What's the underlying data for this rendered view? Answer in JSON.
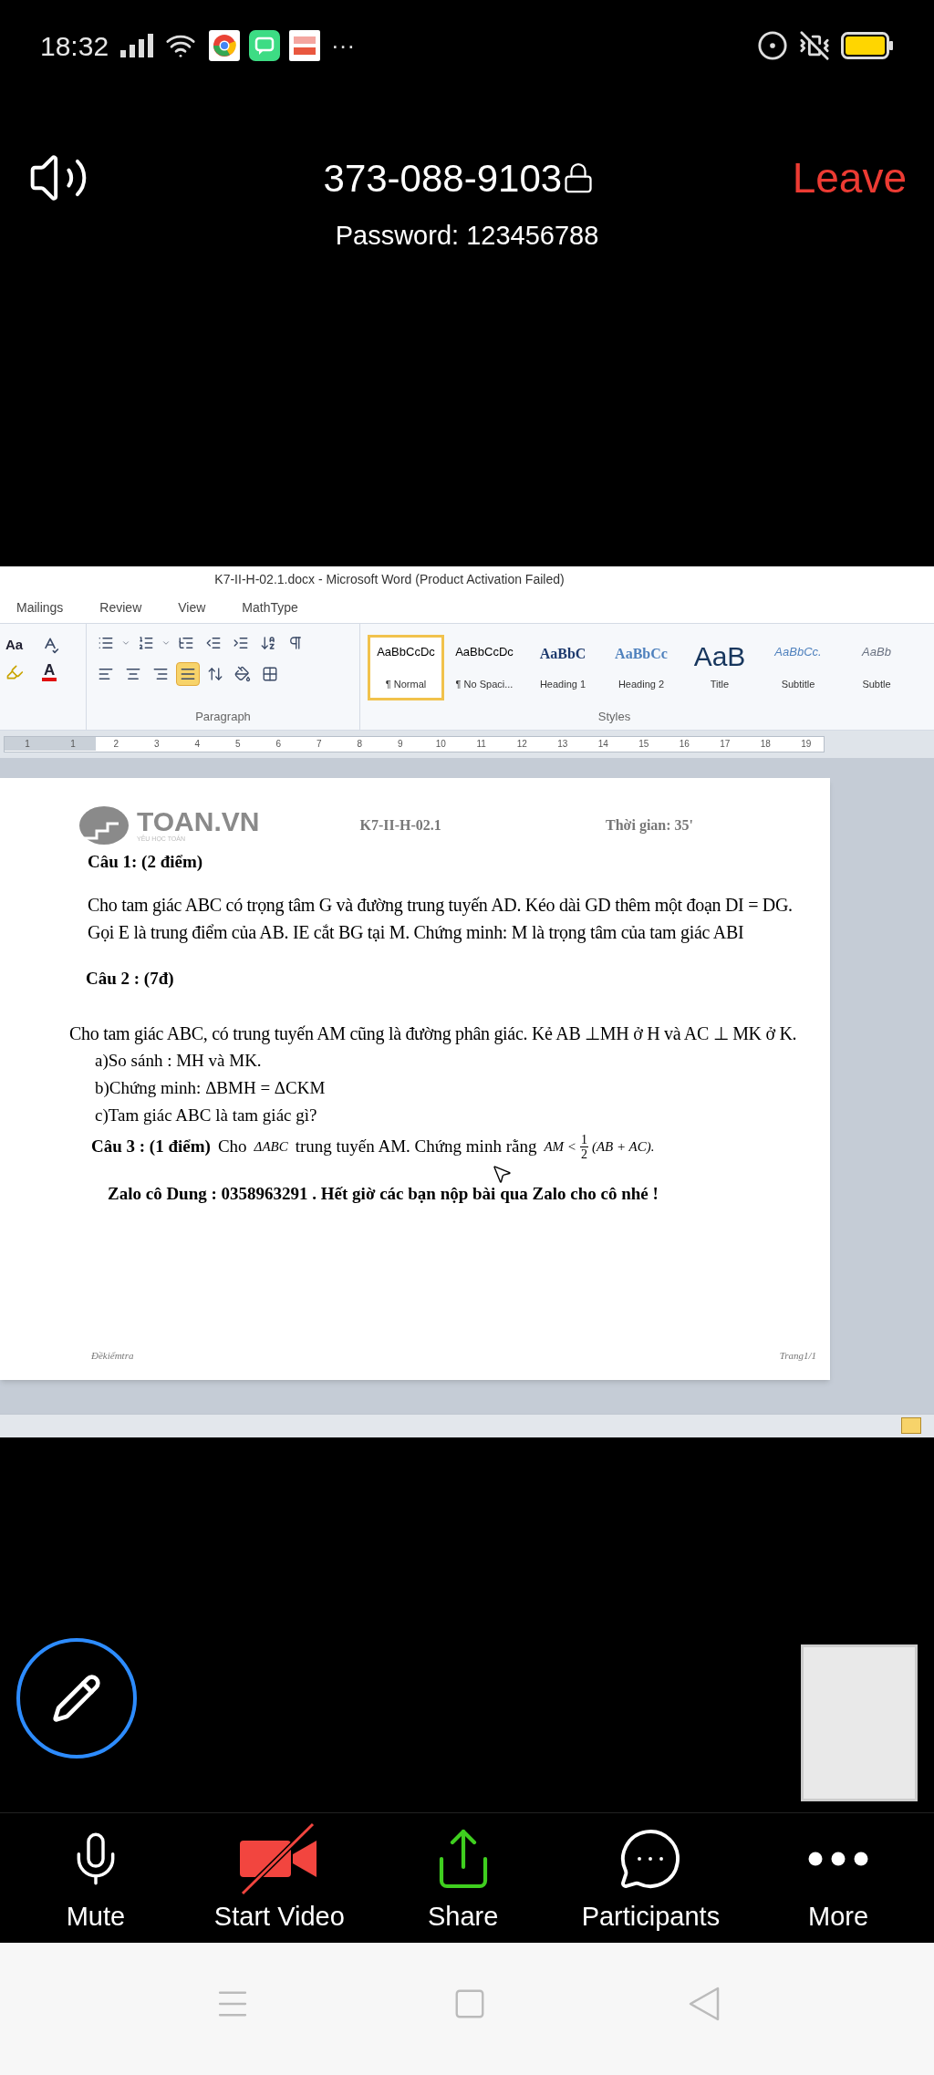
{
  "status_bar": {
    "time": "18:32",
    "more_notifications": "···"
  },
  "meeting": {
    "id": "373-088-9103",
    "password": "Password: 123456788",
    "leave": "Leave"
  },
  "word": {
    "title": "K7-II-H-02.1.docx  -  Microsoft Word (Product Activation Failed)",
    "tabs": [
      "Mailings",
      "Review",
      "View",
      "MathType"
    ],
    "font_case_button": "Aa",
    "font_color_button": "A",
    "alignments": [
      {
        "kind": "left",
        "selected": false
      },
      {
        "kind": "center",
        "selected": false
      },
      {
        "kind": "right",
        "selected": false
      },
      {
        "kind": "justify",
        "selected": true
      }
    ],
    "styles": [
      {
        "kind": "normal",
        "preview": "AaBbCcDc",
        "name": "¶ Normal",
        "selected": true
      },
      {
        "kind": "nospacing",
        "preview": "AaBbCcDc",
        "name": "¶ No Spaci...",
        "selected": false
      },
      {
        "kind": "heading1",
        "preview": "AaBbC",
        "name": "Heading 1",
        "selected": false
      },
      {
        "kind": "heading2",
        "preview": "AaBbCc",
        "name": "Heading 2",
        "selected": false
      },
      {
        "kind": "title",
        "preview": "AaB",
        "name": "Title",
        "selected": false
      },
      {
        "kind": "subtitle",
        "preview": "AaBbCc.",
        "name": "Subtitle",
        "selected": false
      },
      {
        "kind": "subtle",
        "preview": "AaBb",
        "name": "Subtle",
        "selected": false
      }
    ],
    "groups": [
      "Paragraph",
      "Styles"
    ],
    "ruler": [
      "1",
      "1",
      "2",
      "3",
      "4",
      "5",
      "6",
      "7",
      "8",
      "9",
      "10",
      "11",
      "12",
      "13",
      "14",
      "15",
      "16",
      "17",
      "18",
      "19"
    ],
    "document": {
      "logo": "TOAN.VN",
      "logo_tagline": "YÊU HỌC TOÁN",
      "code": "K7-II-H-02.1",
      "time": "Thời gian: 35'",
      "q1_label": "Câu 1: (2 điểm)",
      "q1_text": "Cho tam giác ABC có trọng tâm G và đường trung tuyến AD. Kéo dài GD thêm một đoạn DI = DG. Gọi E là trung điểm của AB. IE cắt BG tại M. Chứng minh: M là trọng tâm của tam giác ABI",
      "q2_label": "Câu 2 : (7đ)",
      "q2_text": "Cho tam giác ABC, có trung tuyến AM cũng là đường phân giác. Kẻ  AB ⊥MH ở  H và AC ⊥ MK ở K.",
      "q2_parts": [
        "a)So sánh : MH và MK.",
        "b)Chứng minh: ΔBMH = ΔCKM",
        "c)Tam giác ABC là tam giác gì?"
      ],
      "q3_label": "Câu 3 : (1 điểm)",
      "q3_text_1": "Cho",
      "q3_math_1": "ΔABC",
      "q3_text_2": "trung tuyến AM. Chứng minh rằng",
      "q3_math_2": "AM <",
      "q3_fraction": [
        "1",
        "2"
      ],
      "q3_math_3": "(AB + AC).",
      "note": "Zalo cô Dung : 0358963291 .  Hết giờ  các bạn nộp bài qua Zalo cho cô nhé !",
      "footer_left": "Đềkiểmtra",
      "footer_right": "Trang1/1"
    }
  },
  "toolbar": [
    {
      "kind": "mic",
      "label": "Mute"
    },
    {
      "kind": "video",
      "label": "Start Video"
    },
    {
      "kind": "share",
      "label": "Share"
    },
    {
      "kind": "participants",
      "label": "Participants"
    },
    {
      "kind": "more",
      "label": "More"
    }
  ]
}
